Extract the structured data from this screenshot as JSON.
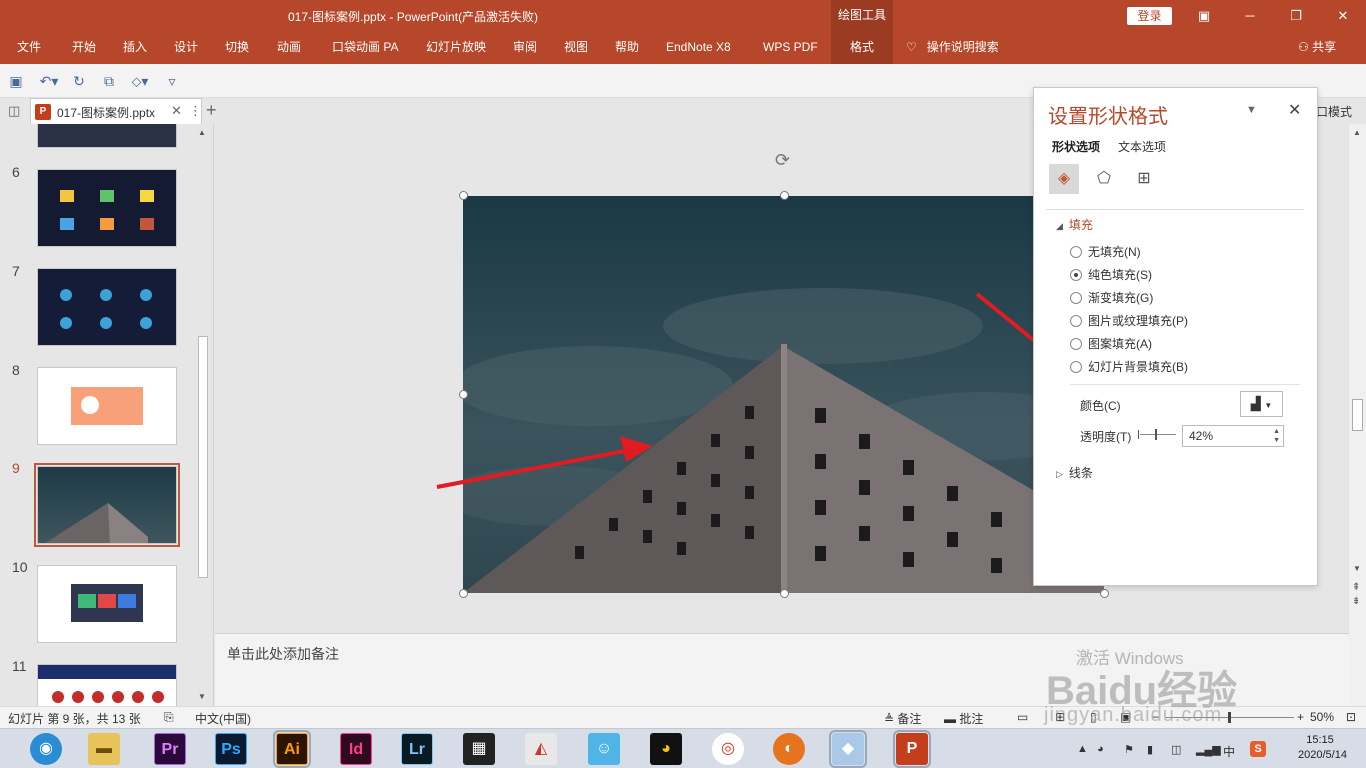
{
  "window": {
    "title": "017-图标案例.pptx  -  PowerPoint(产品激活失败)",
    "context_tab": "绘图工具",
    "login": "登录"
  },
  "ribbon": {
    "tabs": [
      "文件",
      "开始",
      "插入",
      "设计",
      "切换",
      "动画",
      "口袋动画 PA",
      "幻灯片放映",
      "审阅",
      "视图",
      "帮助",
      "EndNote X8",
      "WPS PDF",
      "格式"
    ],
    "active_tab": "格式",
    "tell_me": "操作说明搜索",
    "share": "共享"
  },
  "doc_tab": {
    "name": "017-图标案例.pptx",
    "mode": "口模式"
  },
  "thumbnails": {
    "numbers": [
      "6",
      "7",
      "8",
      "9",
      "10",
      "11"
    ],
    "selected": "9"
  },
  "notes": {
    "placeholder": "单击此处添加备注"
  },
  "format_pane": {
    "title": "设置形状格式",
    "tabs": [
      "形状选项",
      "文本选项"
    ],
    "fill_section": "填充",
    "fill_options": [
      "无填充(N)",
      "纯色填充(S)",
      "渐变填充(G)",
      "图片或纹理填充(P)",
      "图案填充(A)",
      "幻灯片背景填充(B)"
    ],
    "selected_fill": "纯色填充(S)",
    "color_label": "颜色(C)",
    "transparency_label": "透明度(T)",
    "transparency_value": "42%",
    "line_section": "线条"
  },
  "status": {
    "slide_info": "幻灯片 第 9 张，共 13 张",
    "language": "中文(中国)",
    "notes_btn": "备注",
    "comments_btn": "批注",
    "zoom": "50%"
  },
  "taskbar": {
    "apps": [
      "Pr",
      "Ps",
      "Ai",
      "Id",
      "Lr"
    ],
    "ime": "中",
    "time": "15:15",
    "date": "2020/5/14"
  },
  "watermark": {
    "activate": "激活 Windows",
    "brand": "Baidu经验",
    "url": "jingyan.baidu.com"
  },
  "colors": {
    "accent": "#b7472a",
    "pane_title": "#b7472a",
    "arrow": "#e11b22"
  }
}
